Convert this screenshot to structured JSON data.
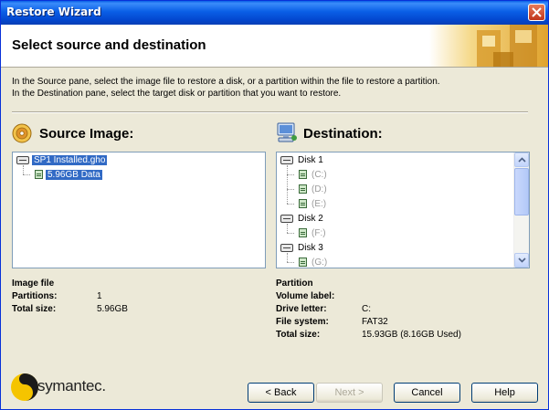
{
  "window": {
    "title": "Restore Wizard"
  },
  "header": {
    "title": "Select source and destination"
  },
  "instructions": {
    "line1": "In the Source pane, select the image file to restore a disk, or a partition within the file to restore a partition.",
    "line2": "In the Destination pane, select the target disk or partition that you want to restore."
  },
  "source": {
    "heading": "Source Image:",
    "tree": {
      "file": "SP1 Installed.gho",
      "partition": "5.96GB Data"
    },
    "info": {
      "section": "Image file",
      "partitions_label": "Partitions:",
      "partitions_value": "1",
      "size_label": "Total size:",
      "size_value": "5.96GB"
    }
  },
  "destination": {
    "heading": "Destination:",
    "tree": {
      "disk1": "Disk 1",
      "c": "(C:)",
      "d": "(D:)",
      "e": "(E:)",
      "disk2": "Disk 2",
      "f": "(F:)",
      "disk3": "Disk 3",
      "g": "(G:)"
    },
    "info": {
      "section": "Partition",
      "volume_label": "Volume label:",
      "volume_value": "",
      "drive_label": "Drive letter:",
      "drive_value": "C:",
      "fs_label": "File system:",
      "fs_value": "FAT32",
      "size_label": "Total size:",
      "size_value": "15.93GB (8.16GB Used)"
    }
  },
  "footer": {
    "brand": "symantec.",
    "back_label": "< Back",
    "next_label": "Next >",
    "cancel_label": "Cancel",
    "help_label": "Help"
  },
  "colors": {
    "titlebar": "#0a5fe6",
    "selection": "#316ac5",
    "dialog_bg": "#ece9d8"
  }
}
